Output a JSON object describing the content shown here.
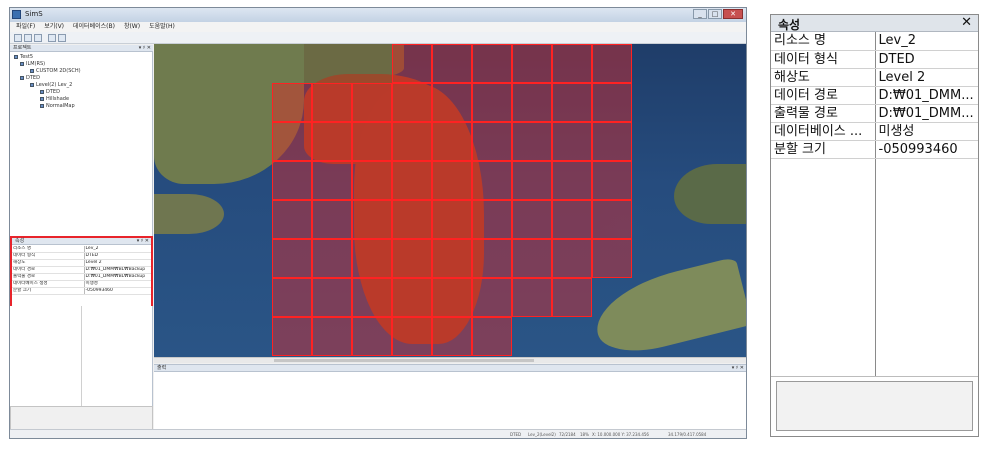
{
  "app": {
    "title": "SimS",
    "menu": [
      "파일(F)",
      "보기(V)",
      "데이터베이스(B)",
      "창(W)",
      "도움말(H)"
    ],
    "window_buttons": {
      "minimize": "_",
      "maximize": "□",
      "close": "✕"
    }
  },
  "explorer": {
    "title": "프로젝트",
    "controls": "▾ ♯ ✕",
    "tree": [
      "Test5",
      "ILM(RS)",
      "CUSTOM 2D(SCH)",
      "DTED",
      "Level(2) Lev_2",
      "DTED",
      "Hillshade",
      "NormalMap"
    ]
  },
  "props_small": {
    "title": "속성",
    "controls": "▾ ♯ ✕",
    "rows": [
      {
        "k": "리소스 명",
        "v": "Lev_2"
      },
      {
        "k": "데이터 형식",
        "v": "DTED"
      },
      {
        "k": "해상도",
        "v": "Level 2"
      },
      {
        "k": "데이터 경로",
        "v": "D:₩01_DMM₩BL₩Backup"
      },
      {
        "k": "출력물 경로",
        "v": "D:₩01_DMM₩BL₩Backup"
      },
      {
        "k": "데이터베이스 생성",
        "v": "미생성"
      },
      {
        "k": "분할 크기",
        "v": "-050993460"
      }
    ]
  },
  "output": {
    "title": "출력",
    "controls": "▾ ♯ ✕"
  },
  "statusbar": [
    "DTED",
    "Lev_2(Level2)",
    "72/2184",
    "18%",
    "X: 10.000.000 Y: 37.234.456",
    "34.179/0.417.0584"
  ],
  "zoom_panel": {
    "title": "속성",
    "close": "✕",
    "rows": [
      {
        "k": "리소스 명",
        "v": "Lev_2"
      },
      {
        "k": "데이터 형식",
        "v": "DTED"
      },
      {
        "k": "해상도",
        "v": "Level 2"
      },
      {
        "k": "데이터 경로",
        "v": "D:₩01_DMM..."
      },
      {
        "k": "출력물 경로",
        "v": "D:₩01_DMM..."
      },
      {
        "k": "데이터베이스 ...",
        "v": "미생성"
      },
      {
        "k": "분할 크기",
        "v": "-050993460"
      }
    ]
  },
  "icons": [
    "app-icon",
    "new-icon",
    "open-icon",
    "save-icon",
    "cut-icon",
    "zoom-icon"
  ],
  "colors": {
    "selection_outline": "#e8242b",
    "tile_fill": "#e12828",
    "tile_border": "#ff2222"
  }
}
